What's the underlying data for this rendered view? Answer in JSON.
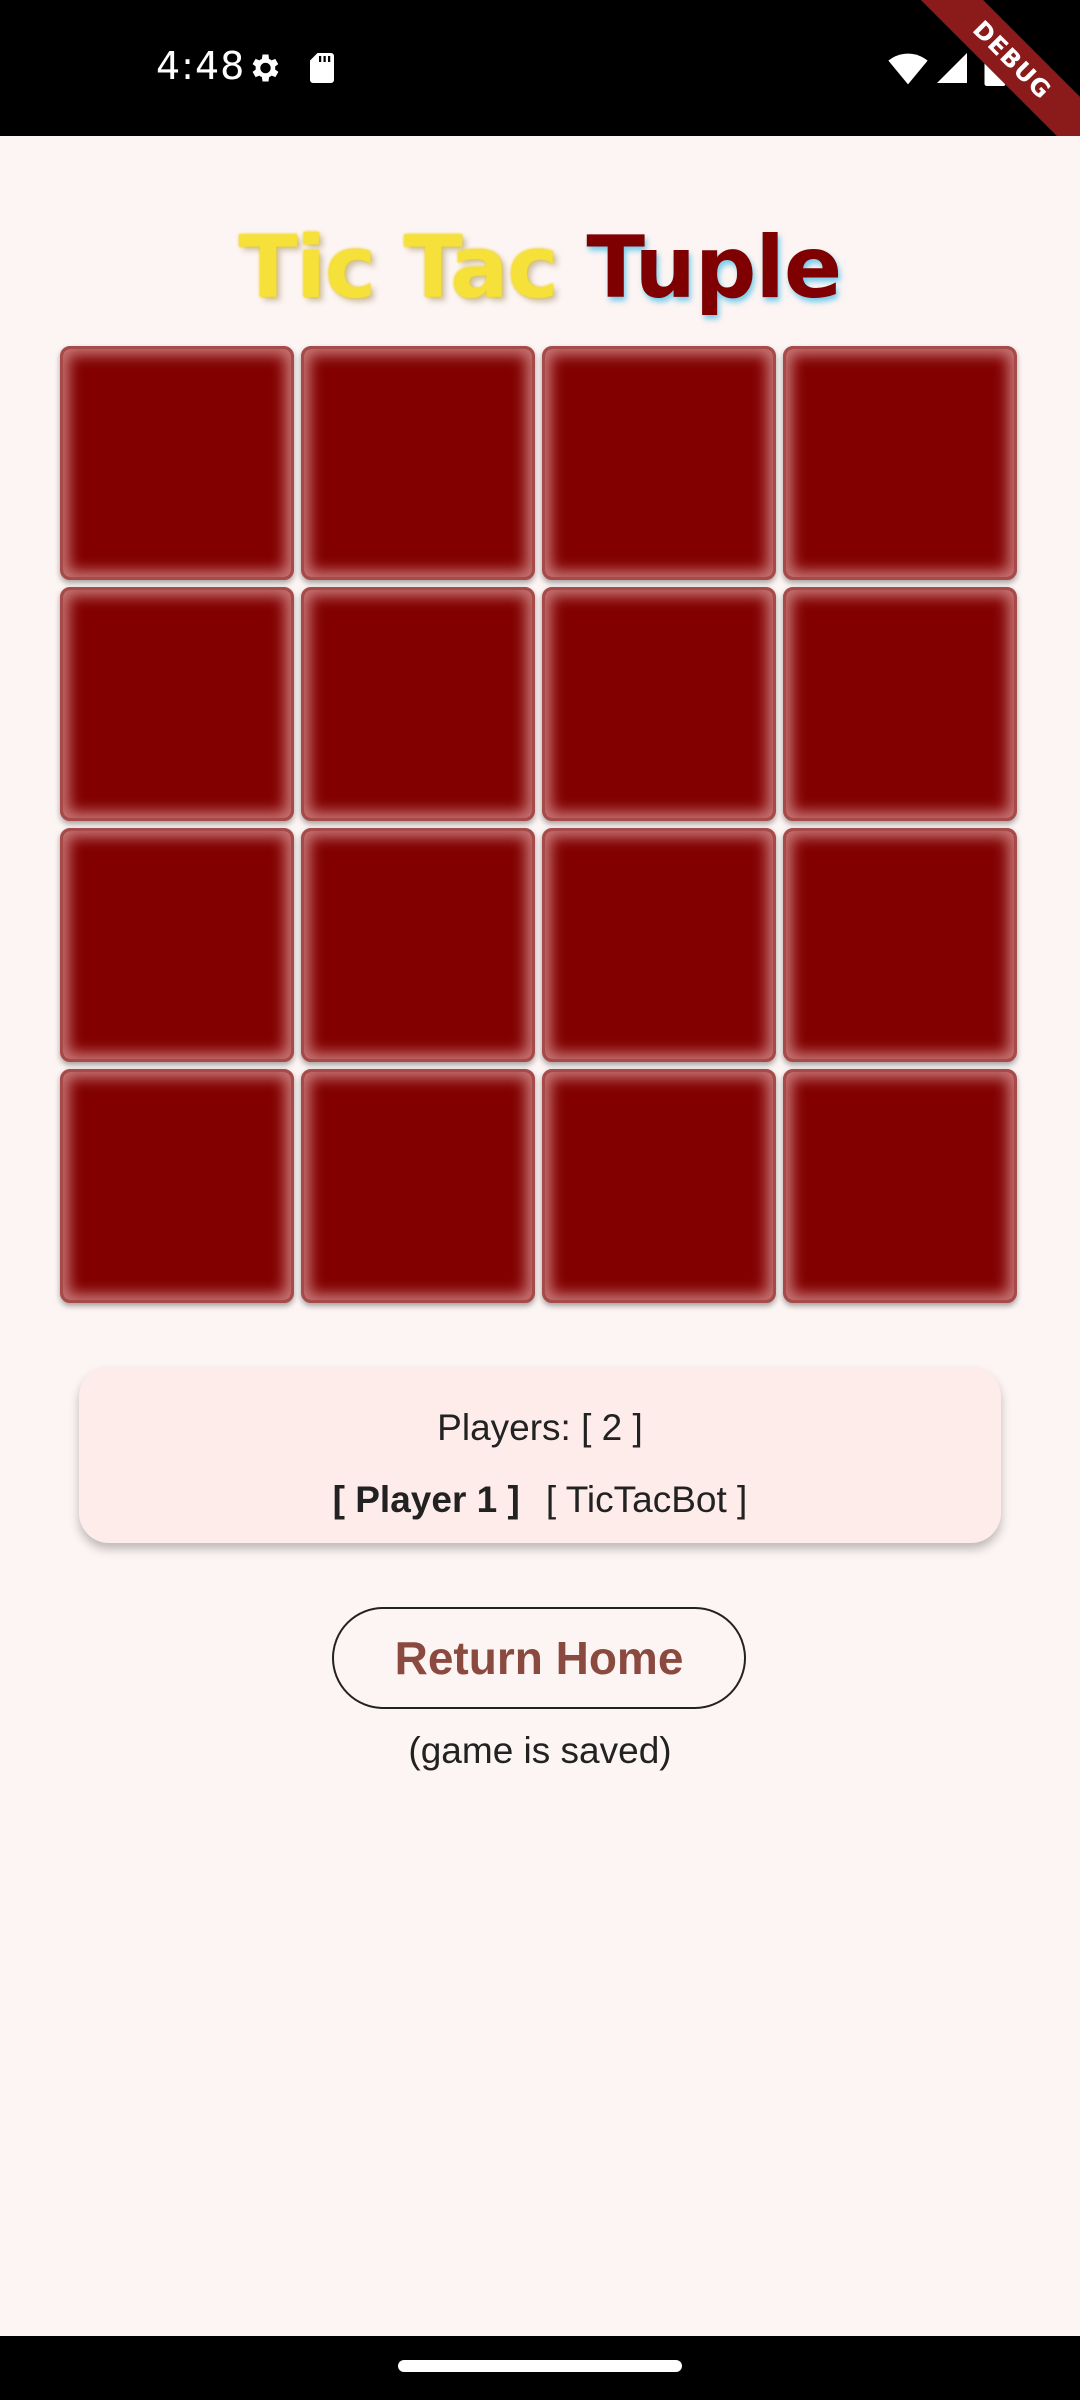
{
  "status_bar": {
    "time": "4:48",
    "icons": [
      "gear-icon",
      "sd-card-icon",
      "wifi-icon",
      "signal-icon",
      "battery-icon"
    ],
    "debug_label": "DEBUG"
  },
  "title": {
    "part1": "Tic Tac ",
    "part2": "Tuple",
    "colors": {
      "part1": "#f6e03a",
      "part2": "#7e0000"
    }
  },
  "board": {
    "rows": 4,
    "cols": 4,
    "cells": [
      [
        "",
        "",
        "",
        ""
      ],
      [
        "",
        "",
        "",
        ""
      ],
      [
        "",
        "",
        "",
        ""
      ],
      [
        "",
        "",
        "",
        ""
      ]
    ],
    "cell_color": "#820000"
  },
  "players": {
    "count_label": "Players: [ 2 ]",
    "current": "[ Player 1 ]",
    "other": "[ TicTacBot ]"
  },
  "actions": {
    "return_home_label": "Return Home",
    "saved_note": "(game is saved)"
  },
  "colors": {
    "background": "#fdf5f3",
    "card": "#fdecea",
    "button_text": "#8b4a40"
  }
}
